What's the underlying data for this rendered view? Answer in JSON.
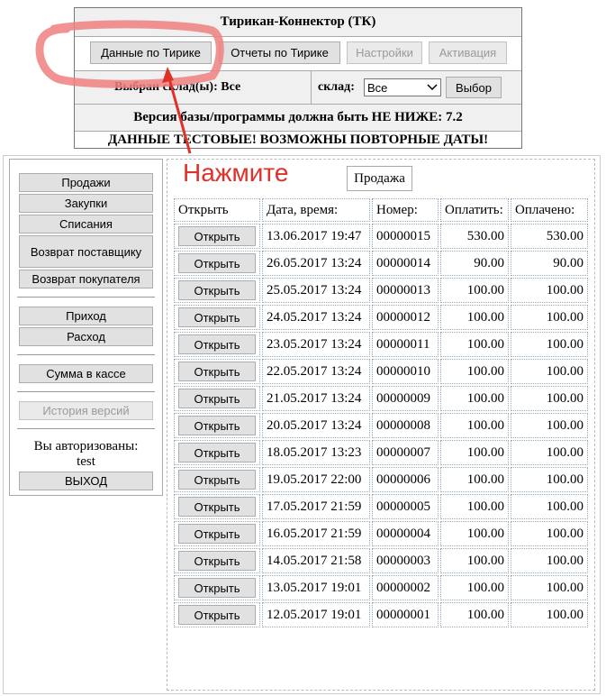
{
  "header": {
    "title": "Тирикан-Коннектор   (ТК)",
    "tabs": [
      {
        "label": "Данные по Тирике",
        "disabled": false
      },
      {
        "label": "Отчеты по Тирике",
        "disabled": false
      },
      {
        "label": "Настройки",
        "disabled": true
      },
      {
        "label": "Активация",
        "disabled": true
      }
    ],
    "selected_label": "Выбран склад(ы): Все",
    "warehouse_label": "склад:",
    "warehouse_value": "Все",
    "select_button": "Выбор",
    "version_notice": "Версия базы/программы должна быть НЕ НИЖЕ: 7.2",
    "test_notice": "ДАННЫЕ ТЕСТОВЫЕ! ВОЗМОЖНЫ ПОВТОРНЫЕ ДАТЫ!"
  },
  "annotation": {
    "text": "Нажмите",
    "color": "#e0302a",
    "highlight_color": "#f08080"
  },
  "sidebar": {
    "group1": [
      "Продажи",
      "Закупки",
      "Списания",
      "Возврат поставщику",
      "Возврат покупателя"
    ],
    "group2": [
      "Приход",
      "Расход"
    ],
    "cash": "Сумма в кассе",
    "history": "История версий",
    "auth_label": "Вы авторизованы:",
    "user": "test",
    "logout": "ВЫХОД"
  },
  "content": {
    "tab": "Продажа",
    "columns": [
      "Открыть",
      "Дата, время:",
      "Номер:",
      "Оплатить:",
      "Оплачено:"
    ],
    "open_label": "Открыть",
    "rows": [
      {
        "date": "13.06.2017 19:47",
        "number": "00000015",
        "to_pay": "530.00",
        "paid": "530.00"
      },
      {
        "date": "26.05.2017 13:24",
        "number": "00000014",
        "to_pay": "90.00",
        "paid": "90.00"
      },
      {
        "date": "25.05.2017 13:24",
        "number": "00000013",
        "to_pay": "100.00",
        "paid": "100.00"
      },
      {
        "date": "24.05.2017 13:24",
        "number": "00000012",
        "to_pay": "100.00",
        "paid": "100.00"
      },
      {
        "date": "23.05.2017 13:24",
        "number": "00000011",
        "to_pay": "100.00",
        "paid": "100.00"
      },
      {
        "date": "22.05.2017 13:24",
        "number": "00000010",
        "to_pay": "100.00",
        "paid": "100.00"
      },
      {
        "date": "21.05.2017 13:24",
        "number": "00000009",
        "to_pay": "100.00",
        "paid": "100.00"
      },
      {
        "date": "20.05.2017 13:24",
        "number": "00000008",
        "to_pay": "100.00",
        "paid": "100.00"
      },
      {
        "date": "18.05.2017 13:23",
        "number": "00000007",
        "to_pay": "100.00",
        "paid": "100.00"
      },
      {
        "date": "19.05.2017 22:00",
        "number": "00000006",
        "to_pay": "100.00",
        "paid": "100.00"
      },
      {
        "date": "17.05.2017 21:59",
        "number": "00000005",
        "to_pay": "100.00",
        "paid": "100.00"
      },
      {
        "date": "16.05.2017 21:59",
        "number": "00000004",
        "to_pay": "100.00",
        "paid": "100.00"
      },
      {
        "date": "14.05.2017 21:58",
        "number": "00000003",
        "to_pay": "100.00",
        "paid": "100.00"
      },
      {
        "date": "13.05.2017 19:01",
        "number": "00000002",
        "to_pay": "100.00",
        "paid": "100.00"
      },
      {
        "date": "12.05.2017 19:01",
        "number": "00000001",
        "to_pay": "100.00",
        "paid": "100.00"
      }
    ]
  }
}
